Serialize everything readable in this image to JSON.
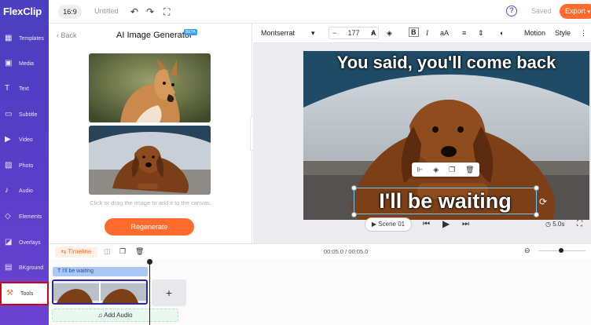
{
  "app": {
    "name": "FlexClip"
  },
  "sidebar": {
    "items": [
      {
        "label": "Templates",
        "icon": "templates-icon"
      },
      {
        "label": "Media",
        "icon": "media-icon"
      },
      {
        "label": "Text",
        "icon": "text-icon"
      },
      {
        "label": "Subtitle",
        "icon": "subtitle-icon"
      },
      {
        "label": "Video",
        "icon": "video-icon"
      },
      {
        "label": "Photo",
        "icon": "photo-icon"
      },
      {
        "label": "Audio",
        "icon": "audio-icon"
      },
      {
        "label": "Elements",
        "icon": "elements-icon"
      },
      {
        "label": "Overlays",
        "icon": "overlays-icon"
      },
      {
        "label": "BKground",
        "icon": "background-icon"
      },
      {
        "label": "Tools",
        "icon": "tools-icon",
        "active": true
      }
    ]
  },
  "topbar": {
    "ratio": "16:9",
    "title": "Untitled",
    "saved": "Saved",
    "export": "Export"
  },
  "panel": {
    "back": "Back",
    "title": "AI Image Generator",
    "badge": "BETA",
    "hint": "Click or drag the image to add it to the canvas.",
    "regenerate": "Regenerate"
  },
  "format_toolbar": {
    "font": "Montserrat",
    "size": "177",
    "motion": "Motion",
    "style": "Style"
  },
  "canvas": {
    "caption_top": "You said, you'll come back",
    "caption_bottom": "I'll be waiting",
    "scene": "Scene 01",
    "duration": "5.0s"
  },
  "timeline": {
    "label": "Timeline",
    "time": "00:05.0 / 00:05.0",
    "subtitle_clip": "I'll be waiting",
    "add_audio": "Add Audio"
  },
  "colors": {
    "accent": "#ff6b2b",
    "brand": "#5a3ec9",
    "selection": "#6cc9ff"
  }
}
